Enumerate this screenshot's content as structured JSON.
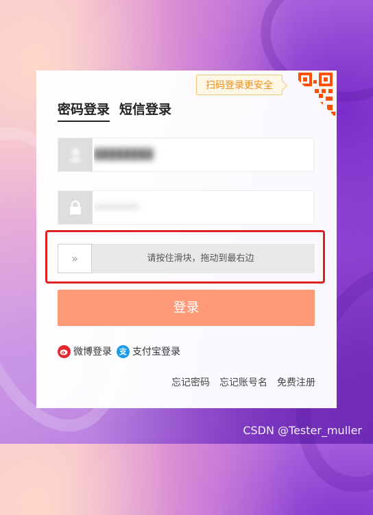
{
  "qr_prompt": "扫码登录更安全",
  "tabs": [
    {
      "label": "密码登录",
      "active": true
    },
    {
      "label": "短信登录",
      "active": false
    }
  ],
  "username": {
    "value": "████████",
    "icon": "user-icon"
  },
  "password": {
    "value": "••••••••",
    "icon": "lock-icon"
  },
  "slider": {
    "handle_glyph": "»",
    "instruction": "请按住滑块，拖动到最右边"
  },
  "login_button": "登录",
  "social": {
    "weibo": {
      "label": "微博登录",
      "icon": "weibo-icon",
      "color": "#e6282e"
    },
    "alipay": {
      "label": "支付宝登录",
      "icon": "alipay-icon",
      "glyph": "支",
      "color": "#1e9be8"
    }
  },
  "links": {
    "forgot_password": "忘记密码",
    "forgot_account": "忘记账号名",
    "register": "免费注册"
  },
  "watermark": "CSDN @Tester_muller",
  "colors": {
    "accent": "#ff9a78",
    "highlight": "#e02020",
    "qr_orange": "#ff5000"
  }
}
